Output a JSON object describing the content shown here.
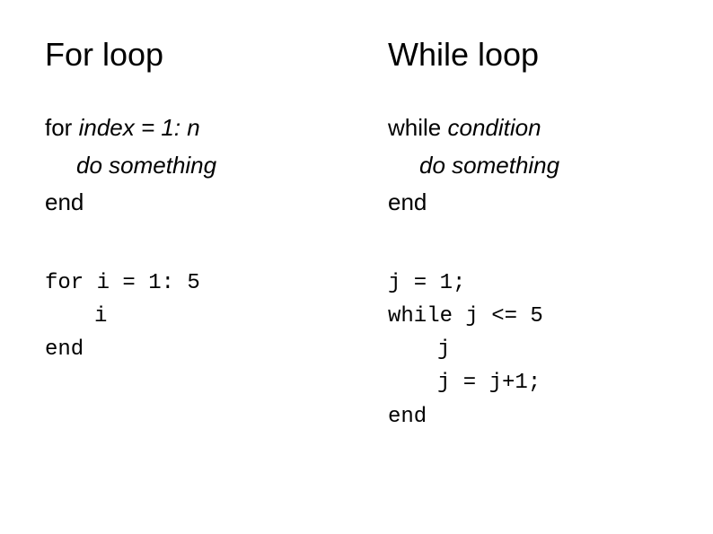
{
  "left": {
    "heading": "For loop",
    "syntax": {
      "line1_kw": "for ",
      "line1_it": "index = 1: n",
      "line2": "do something",
      "line3": "end"
    },
    "code": {
      "line1": "for i = 1: 5",
      "line2": "i",
      "line3": "end"
    }
  },
  "right": {
    "heading": "While loop",
    "syntax": {
      "line1_kw": "while ",
      "line1_it": "condition",
      "line2": "do something",
      "line3": "end"
    },
    "code": {
      "line1": "j = 1;",
      "line2": "while j <= 5",
      "line3": "j",
      "line4": "j = j+1;",
      "line5": "end"
    }
  }
}
